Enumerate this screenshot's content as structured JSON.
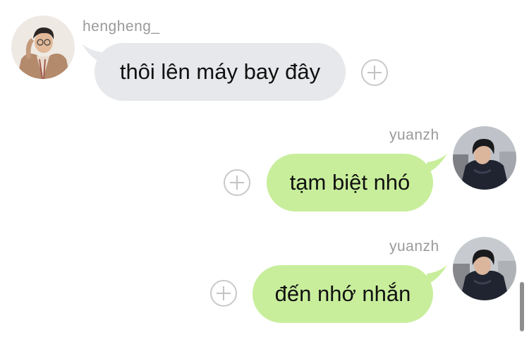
{
  "messages": [
    {
      "sender": "hengheng_",
      "text": "thôi lên máy bay đây",
      "direction": "incoming"
    },
    {
      "sender": "yuanzh",
      "text": "tạm biệt nhó",
      "direction": "outgoing"
    },
    {
      "sender": "yuanzh",
      "text": "đến nhớ nhắn",
      "direction": "outgoing"
    }
  ],
  "colors": {
    "incoming_bubble": "#e6e8eb",
    "outgoing_bubble": "#c8ee9c",
    "sender_name": "#9a9a9a"
  },
  "icons": {
    "reaction_button": "plus-circle-icon"
  }
}
